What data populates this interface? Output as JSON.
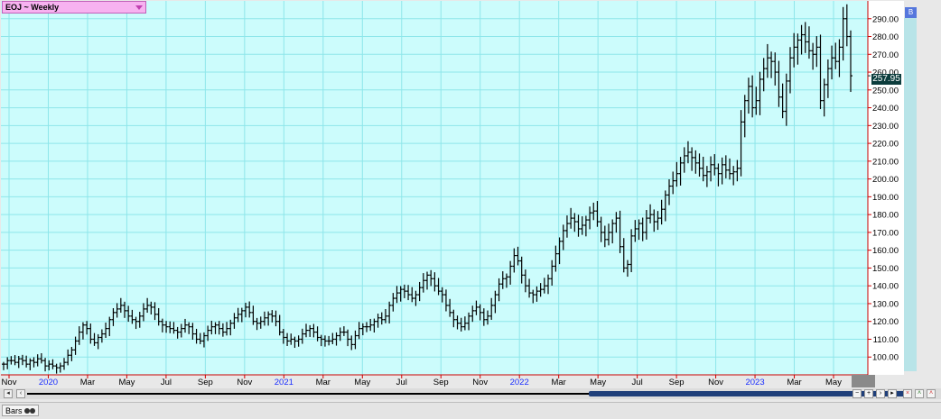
{
  "header": {
    "symbol_label": "EOJ ~ Weekly",
    "flag_label": "B"
  },
  "last_price_label": "257.95",
  "status_bar": {
    "tab_label": "Bars"
  },
  "colors": {
    "plot_bg": "#ccfcfc",
    "grid": "#8ee6ea",
    "axis": "#cc0000",
    "bars": "#000000",
    "year_label": "#1a2eff"
  },
  "chart_data": {
    "type": "ohlc",
    "title": "EOJ ~ Weekly",
    "xlabel": "",
    "ylabel": "",
    "ylim": [
      90,
      300
    ],
    "grid": true,
    "y_ticks": [
      "100.00",
      "110.00",
      "120.00",
      "130.00",
      "140.00",
      "150.00",
      "160.00",
      "170.00",
      "180.00",
      "190.00",
      "200.00",
      "210.00",
      "220.00",
      "230.00",
      "240.00",
      "250.00",
      "260.00",
      "270.00",
      "280.00",
      "290.00"
    ],
    "x_ticks": [
      {
        "label": "Nov",
        "year": false
      },
      {
        "label": "2020",
        "year": true
      },
      {
        "label": "Mar",
        "year": false
      },
      {
        "label": "May",
        "year": false
      },
      {
        "label": "Jul",
        "year": false
      },
      {
        "label": "Sep",
        "year": false
      },
      {
        "label": "Nov",
        "year": false
      },
      {
        "label": "2021",
        "year": true
      },
      {
        "label": "Mar",
        "year": false
      },
      {
        "label": "May",
        "year": false
      },
      {
        "label": "Jul",
        "year": false
      },
      {
        "label": "Sep",
        "year": false
      },
      {
        "label": "Nov",
        "year": false
      },
      {
        "label": "2022",
        "year": true
      },
      {
        "label": "Mar",
        "year": false
      },
      {
        "label": "May",
        "year": false
      },
      {
        "label": "Jul",
        "year": false
      },
      {
        "label": "Sep",
        "year": false
      },
      {
        "label": "Nov",
        "year": false
      },
      {
        "label": "2023",
        "year": true
      },
      {
        "label": "Mar",
        "year": false
      },
      {
        "label": "May",
        "year": false
      }
    ],
    "last_price": 257.95,
    "closes": [
      96,
      98,
      98,
      97,
      99,
      98,
      96,
      98,
      97,
      99,
      98,
      95,
      96,
      95,
      94,
      95,
      97,
      101,
      104,
      109,
      114,
      118,
      116,
      110,
      108,
      111,
      113,
      116,
      121,
      125,
      127,
      129,
      126,
      123,
      121,
      120,
      123,
      127,
      129,
      128,
      124,
      120,
      118,
      117,
      116,
      115,
      114,
      116,
      118,
      117,
      113,
      110,
      109,
      112,
      115,
      117,
      118,
      116,
      114,
      116,
      119,
      122,
      124,
      126,
      128,
      125,
      120,
      119,
      120,
      122,
      124,
      123,
      120,
      114,
      111,
      109,
      110,
      109,
      110,
      113,
      115,
      116,
      114,
      111,
      110,
      109,
      109,
      110,
      112,
      114,
      114,
      110,
      107,
      112,
      116,
      117,
      117,
      118,
      120,
      122,
      121,
      123,
      129,
      133,
      136,
      138,
      137,
      135,
      133,
      135,
      139,
      143,
      146,
      144,
      140,
      137,
      135,
      129,
      125,
      121,
      119,
      117,
      119,
      123,
      126,
      128,
      125,
      121,
      123,
      129,
      135,
      141,
      144,
      145,
      151,
      157,
      154,
      146,
      140,
      136,
      135,
      137,
      138,
      140,
      144,
      151,
      158,
      165,
      171,
      175,
      178,
      176,
      172,
      174,
      177,
      181,
      182,
      176,
      170,
      166,
      170,
      175,
      178,
      162,
      150,
      152,
      168,
      172,
      175,
      170,
      178,
      180,
      176,
      178,
      183,
      191,
      196,
      199,
      203,
      209,
      213,
      215,
      212,
      209,
      206,
      202,
      204,
      208,
      206,
      203,
      208,
      205,
      203,
      204,
      206,
      232,
      244,
      252,
      240,
      244,
      256,
      262,
      268,
      266,
      260,
      246,
      238,
      255,
      268,
      274,
      278,
      281,
      277,
      272,
      270,
      274,
      244,
      253,
      262,
      268,
      266,
      274,
      290,
      280,
      257.95
    ]
  }
}
